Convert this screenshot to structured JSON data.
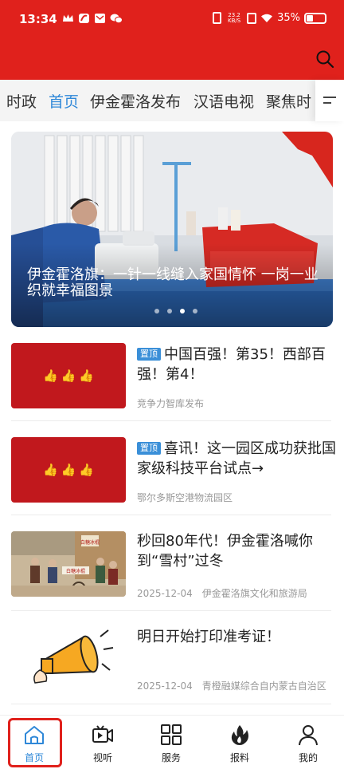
{
  "status_bar": {
    "time": "13:34",
    "net_speed_value": "23.2",
    "net_speed_unit": "KB/S",
    "battery": "35%"
  },
  "header": {
    "search_icon": "search-icon",
    "brand_color": "#e0211c"
  },
  "tabs": {
    "items": [
      {
        "label": "时政"
      },
      {
        "label": "首页"
      },
      {
        "label": "伊金霍洛发布"
      },
      {
        "label": "汉语电视"
      },
      {
        "label": "聚焦时"
      }
    ],
    "active_index": 1,
    "active_color": "#2f88d8"
  },
  "banner": {
    "caption": "伊金霍洛旗：一针一线缝入家国情怀  一岗一业织就幸福图景",
    "slide_count": 4,
    "active_slide": 3
  },
  "feed": [
    {
      "badge": "置顶",
      "title": "中国百强！第35！西部百强！第4！",
      "date": "",
      "source": "竞争力智库发布"
    },
    {
      "badge": "置顶",
      "title": "喜讯！这一园区成功获批国家级科技平台试点→",
      "date": "",
      "source": "鄂尔多斯空港物流园区"
    },
    {
      "badge": "",
      "title": "秒回80年代！伊金霍洛喊你到“雪村”过冬",
      "date": "2025-12-04",
      "source": "伊金霍洛旗文化和旅游局"
    },
    {
      "badge": "",
      "title": "明日开始打印准考证！",
      "date": "2025-12-04",
      "source": "青橙融媒综合自内蒙古自治区"
    }
  ],
  "thumb_text": {
    "shop_sign": "白糖冰棍",
    "cart_sign": "白糖冰棍"
  },
  "bottom_nav": {
    "items": [
      {
        "label": "首页",
        "icon": "home-icon"
      },
      {
        "label": "视听",
        "icon": "video-icon"
      },
      {
        "label": "服务",
        "icon": "grid-icon"
      },
      {
        "label": "报料",
        "icon": "flame-icon"
      },
      {
        "label": "我的",
        "icon": "user-icon"
      }
    ],
    "active_index": 0
  }
}
